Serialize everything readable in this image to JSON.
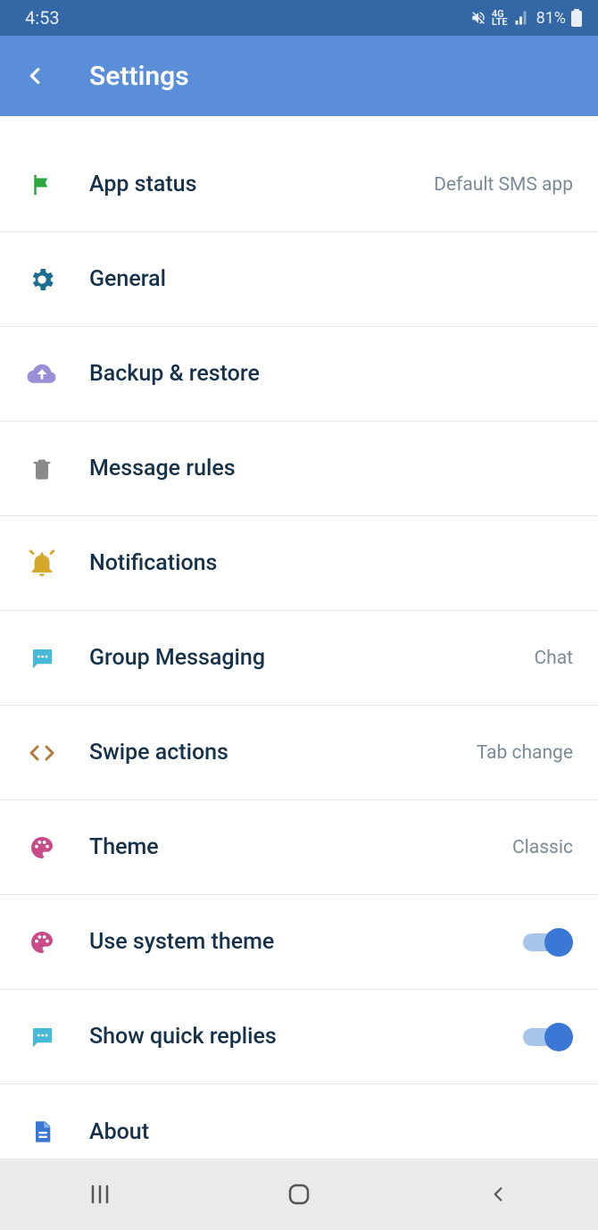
{
  "status": {
    "time": "4:53",
    "battery": "81%"
  },
  "header": {
    "title": "Settings"
  },
  "rows": {
    "app_status": {
      "label": "App status",
      "value": "Default SMS app"
    },
    "general": {
      "label": "General"
    },
    "backup": {
      "label": "Backup & restore"
    },
    "rules": {
      "label": "Message rules"
    },
    "notifications": {
      "label": "Notifications"
    },
    "group": {
      "label": "Group Messaging",
      "value": "Chat"
    },
    "swipe": {
      "label": "Swipe actions",
      "value": "Tab change"
    },
    "theme": {
      "label": "Theme",
      "value": "Classic"
    },
    "system_theme": {
      "label": "Use system theme"
    },
    "quick_replies": {
      "label": "Show quick replies"
    },
    "about": {
      "label": "About"
    }
  }
}
